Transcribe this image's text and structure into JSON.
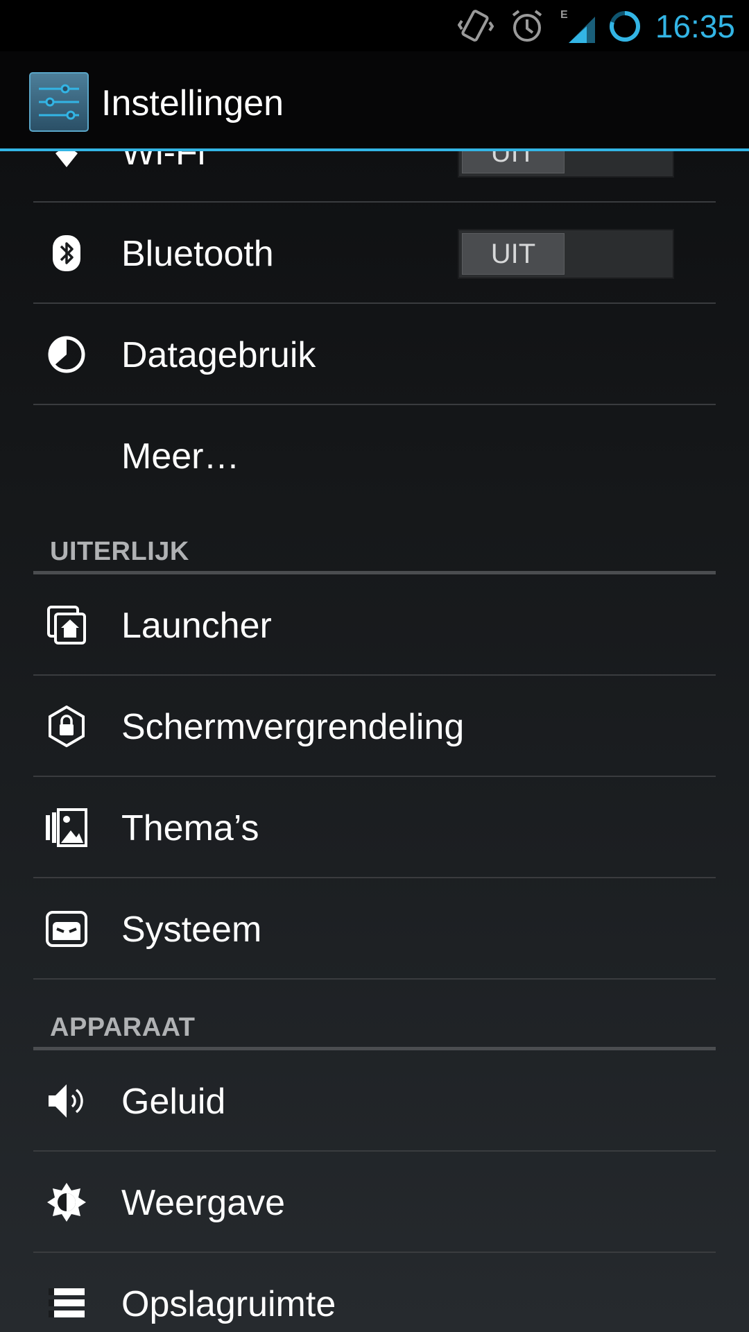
{
  "status_bar": {
    "time": "16:35",
    "network_type": "E",
    "icons": [
      "vibrate-icon",
      "alarm-icon",
      "signal-icon",
      "sync-icon"
    ]
  },
  "action_bar": {
    "title": "Instellingen",
    "icon": "settings-sliders-icon"
  },
  "list": {
    "items": [
      {
        "label": "Wi-Fi",
        "icon": "wifi-icon",
        "toggle": "UIT"
      },
      {
        "label": "Bluetooth",
        "icon": "bluetooth-icon",
        "toggle": "UIT"
      },
      {
        "label": "Datagebruik",
        "icon": "data-usage-icon"
      },
      {
        "label": "Meer…"
      }
    ],
    "sections": [
      {
        "title": "UITERLIJK",
        "items": [
          {
            "label": "Launcher",
            "icon": "launcher-icon"
          },
          {
            "label": "Schermvergrendeling",
            "icon": "lock-icon"
          },
          {
            "label": "Thema’s",
            "icon": "themes-icon"
          },
          {
            "label": "Systeem",
            "icon": "system-icon"
          }
        ]
      },
      {
        "title": "APPARAAT",
        "items": [
          {
            "label": "Geluid",
            "icon": "sound-icon"
          },
          {
            "label": "Weergave",
            "icon": "display-icon"
          },
          {
            "label": "Opslagruimte",
            "icon": "storage-icon"
          }
        ]
      }
    ]
  },
  "colors": {
    "accent": "#33b5e5",
    "text": "#ffffff",
    "section_text": "#b0b2b4",
    "divider": "#3a3c3f"
  }
}
